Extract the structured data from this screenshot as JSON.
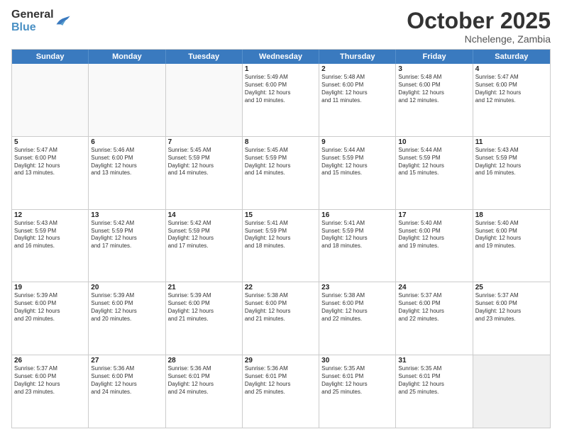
{
  "header": {
    "logo_general": "General",
    "logo_blue": "Blue",
    "title": "October 2025",
    "location": "Nchelenge, Zambia"
  },
  "weekdays": [
    "Sunday",
    "Monday",
    "Tuesday",
    "Wednesday",
    "Thursday",
    "Friday",
    "Saturday"
  ],
  "rows": [
    [
      {
        "day": "",
        "text": "",
        "empty": true
      },
      {
        "day": "",
        "text": "",
        "empty": true
      },
      {
        "day": "",
        "text": "",
        "empty": true
      },
      {
        "day": "1",
        "text": "Sunrise: 5:49 AM\nSunset: 6:00 PM\nDaylight: 12 hours\nand 10 minutes."
      },
      {
        "day": "2",
        "text": "Sunrise: 5:48 AM\nSunset: 6:00 PM\nDaylight: 12 hours\nand 11 minutes."
      },
      {
        "day": "3",
        "text": "Sunrise: 5:48 AM\nSunset: 6:00 PM\nDaylight: 12 hours\nand 12 minutes."
      },
      {
        "day": "4",
        "text": "Sunrise: 5:47 AM\nSunset: 6:00 PM\nDaylight: 12 hours\nand 12 minutes."
      }
    ],
    [
      {
        "day": "5",
        "text": "Sunrise: 5:47 AM\nSunset: 6:00 PM\nDaylight: 12 hours\nand 13 minutes."
      },
      {
        "day": "6",
        "text": "Sunrise: 5:46 AM\nSunset: 6:00 PM\nDaylight: 12 hours\nand 13 minutes."
      },
      {
        "day": "7",
        "text": "Sunrise: 5:45 AM\nSunset: 5:59 PM\nDaylight: 12 hours\nand 14 minutes."
      },
      {
        "day": "8",
        "text": "Sunrise: 5:45 AM\nSunset: 5:59 PM\nDaylight: 12 hours\nand 14 minutes."
      },
      {
        "day": "9",
        "text": "Sunrise: 5:44 AM\nSunset: 5:59 PM\nDaylight: 12 hours\nand 15 minutes."
      },
      {
        "day": "10",
        "text": "Sunrise: 5:44 AM\nSunset: 5:59 PM\nDaylight: 12 hours\nand 15 minutes."
      },
      {
        "day": "11",
        "text": "Sunrise: 5:43 AM\nSunset: 5:59 PM\nDaylight: 12 hours\nand 16 minutes."
      }
    ],
    [
      {
        "day": "12",
        "text": "Sunrise: 5:43 AM\nSunset: 5:59 PM\nDaylight: 12 hours\nand 16 minutes."
      },
      {
        "day": "13",
        "text": "Sunrise: 5:42 AM\nSunset: 5:59 PM\nDaylight: 12 hours\nand 17 minutes."
      },
      {
        "day": "14",
        "text": "Sunrise: 5:42 AM\nSunset: 5:59 PM\nDaylight: 12 hours\nand 17 minutes."
      },
      {
        "day": "15",
        "text": "Sunrise: 5:41 AM\nSunset: 5:59 PM\nDaylight: 12 hours\nand 18 minutes."
      },
      {
        "day": "16",
        "text": "Sunrise: 5:41 AM\nSunset: 5:59 PM\nDaylight: 12 hours\nand 18 minutes."
      },
      {
        "day": "17",
        "text": "Sunrise: 5:40 AM\nSunset: 6:00 PM\nDaylight: 12 hours\nand 19 minutes."
      },
      {
        "day": "18",
        "text": "Sunrise: 5:40 AM\nSunset: 6:00 PM\nDaylight: 12 hours\nand 19 minutes."
      }
    ],
    [
      {
        "day": "19",
        "text": "Sunrise: 5:39 AM\nSunset: 6:00 PM\nDaylight: 12 hours\nand 20 minutes."
      },
      {
        "day": "20",
        "text": "Sunrise: 5:39 AM\nSunset: 6:00 PM\nDaylight: 12 hours\nand 20 minutes."
      },
      {
        "day": "21",
        "text": "Sunrise: 5:39 AM\nSunset: 6:00 PM\nDaylight: 12 hours\nand 21 minutes."
      },
      {
        "day": "22",
        "text": "Sunrise: 5:38 AM\nSunset: 6:00 PM\nDaylight: 12 hours\nand 21 minutes."
      },
      {
        "day": "23",
        "text": "Sunrise: 5:38 AM\nSunset: 6:00 PM\nDaylight: 12 hours\nand 22 minutes."
      },
      {
        "day": "24",
        "text": "Sunrise: 5:37 AM\nSunset: 6:00 PM\nDaylight: 12 hours\nand 22 minutes."
      },
      {
        "day": "25",
        "text": "Sunrise: 5:37 AM\nSunset: 6:00 PM\nDaylight: 12 hours\nand 23 minutes."
      }
    ],
    [
      {
        "day": "26",
        "text": "Sunrise: 5:37 AM\nSunset: 6:00 PM\nDaylight: 12 hours\nand 23 minutes."
      },
      {
        "day": "27",
        "text": "Sunrise: 5:36 AM\nSunset: 6:00 PM\nDaylight: 12 hours\nand 24 minutes."
      },
      {
        "day": "28",
        "text": "Sunrise: 5:36 AM\nSunset: 6:01 PM\nDaylight: 12 hours\nand 24 minutes."
      },
      {
        "day": "29",
        "text": "Sunrise: 5:36 AM\nSunset: 6:01 PM\nDaylight: 12 hours\nand 25 minutes."
      },
      {
        "day": "30",
        "text": "Sunrise: 5:35 AM\nSunset: 6:01 PM\nDaylight: 12 hours\nand 25 minutes."
      },
      {
        "day": "31",
        "text": "Sunrise: 5:35 AM\nSunset: 6:01 PM\nDaylight: 12 hours\nand 25 minutes."
      },
      {
        "day": "",
        "text": "",
        "empty": true,
        "shaded": true
      }
    ]
  ]
}
